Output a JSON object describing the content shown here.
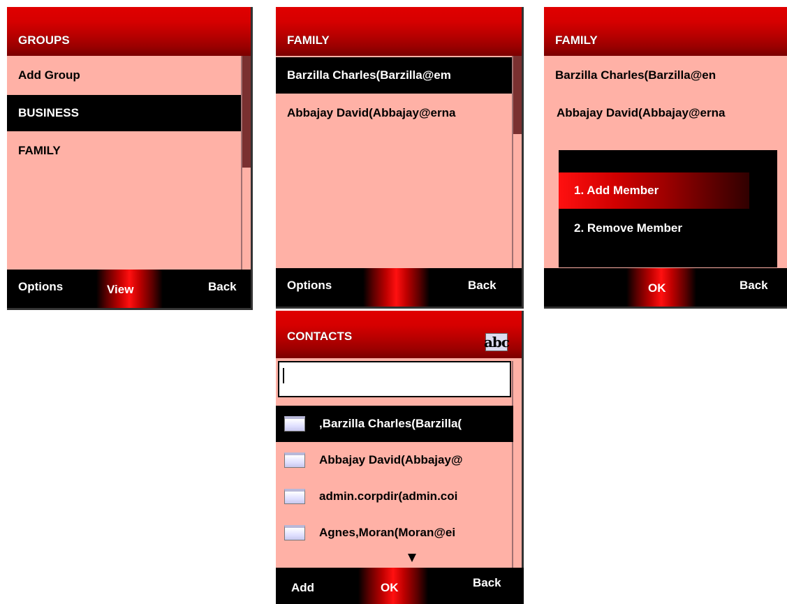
{
  "screen1": {
    "title": "GROUPS",
    "items": [
      "Add Group",
      "BUSINESS",
      "FAMILY"
    ],
    "selected_index": 1,
    "softkeys": {
      "left": "Options",
      "center": "View",
      "right": "Back"
    }
  },
  "screen2": {
    "title": "FAMILY",
    "items": [
      "Barzilla Charles(Barzilla@em",
      "Abbajay David(Abbajay@erna"
    ],
    "selected_index": 0,
    "softkeys": {
      "left": "Options",
      "center": "",
      "right": "Back"
    }
  },
  "screen3": {
    "title": "FAMILY",
    "items": [
      "Barzilla Charles(Barzilla@en",
      "Abbajay David(Abbajay@erna"
    ],
    "menu": {
      "items": [
        "1. Add Member",
        "2. Remove Member"
      ],
      "selected_index": 0
    },
    "softkeys": {
      "left": "",
      "center": "OK",
      "right": "Back"
    }
  },
  "screen4": {
    "title": "CONTACTS",
    "input_mode_icon": "abc",
    "search": {
      "value": "",
      "placeholder": ""
    },
    "contacts": [
      ",Barzilla Charles(Barzilla(",
      "Abbajay David(Abbajay@",
      "admin.corpdir(admin.coi",
      "Agnes,Moran(Moran@ei"
    ],
    "selected_index": 0,
    "softkeys": {
      "left": "Add",
      "center": "OK",
      "right": "Back"
    }
  },
  "colors": {
    "title_bar": "#d00000",
    "list_background": "#ffb1a6",
    "selection": "#000000",
    "softkey_bar": "#000000"
  }
}
